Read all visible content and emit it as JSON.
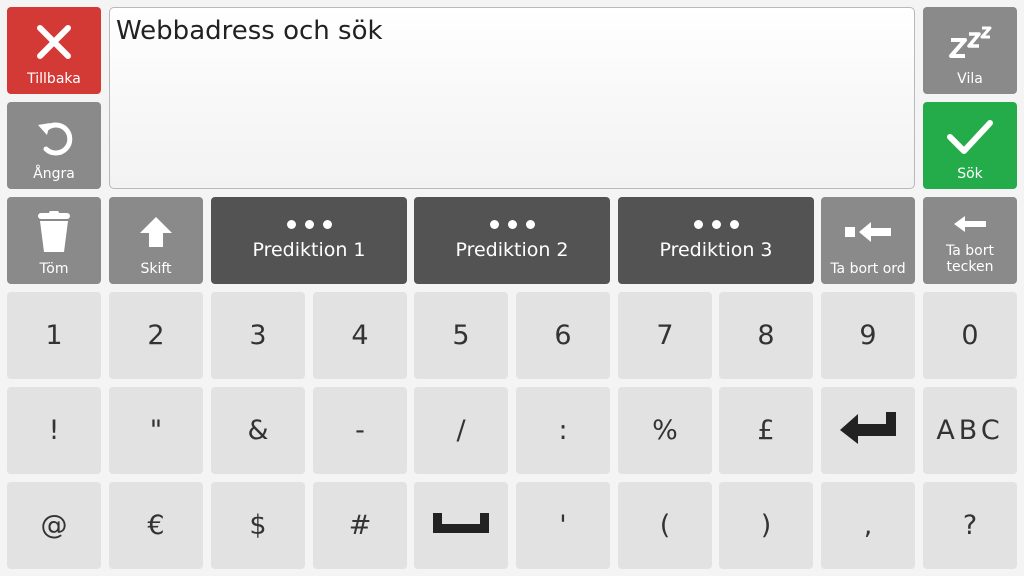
{
  "text_field": {
    "value": "Webbadress och sök"
  },
  "actions": {
    "back": "Tillbaka",
    "undo": "Ångra",
    "sleep": "Vila",
    "search": "Sök",
    "clear": "Töm",
    "shift": "Skift",
    "delete_word": "Ta bort ord",
    "delete_char_line1": "Ta bort",
    "delete_char_line2": "tecken"
  },
  "predictions": [
    "Prediktion 1",
    "Prediktion 2",
    "Prediktion 3"
  ],
  "keys": {
    "row1": [
      "1",
      "2",
      "3",
      "4",
      "5",
      "6",
      "7",
      "8",
      "9",
      "0"
    ],
    "row2": [
      "!",
      "\"",
      "&",
      "-",
      "/",
      ":",
      "%",
      "£",
      "ABC"
    ],
    "row3": [
      "@",
      "€",
      "$",
      "#",
      "'",
      "(",
      ")",
      ",",
      "?"
    ]
  },
  "icons": {
    "back": "close-icon",
    "undo": "undo-icon",
    "sleep": "sleep-icon",
    "search": "check-icon",
    "clear": "trash-icon",
    "shift": "shift-arrow-icon",
    "delete_word": "delete-word-icon",
    "delete_char": "backspace-arrow-icon",
    "enter": "enter-icon",
    "space": "space-icon"
  },
  "colors": {
    "back": "#d33a36",
    "search": "#25ac4a",
    "function": "#8a8a8a",
    "prediction": "#535353",
    "key": "#e2e2e2"
  }
}
